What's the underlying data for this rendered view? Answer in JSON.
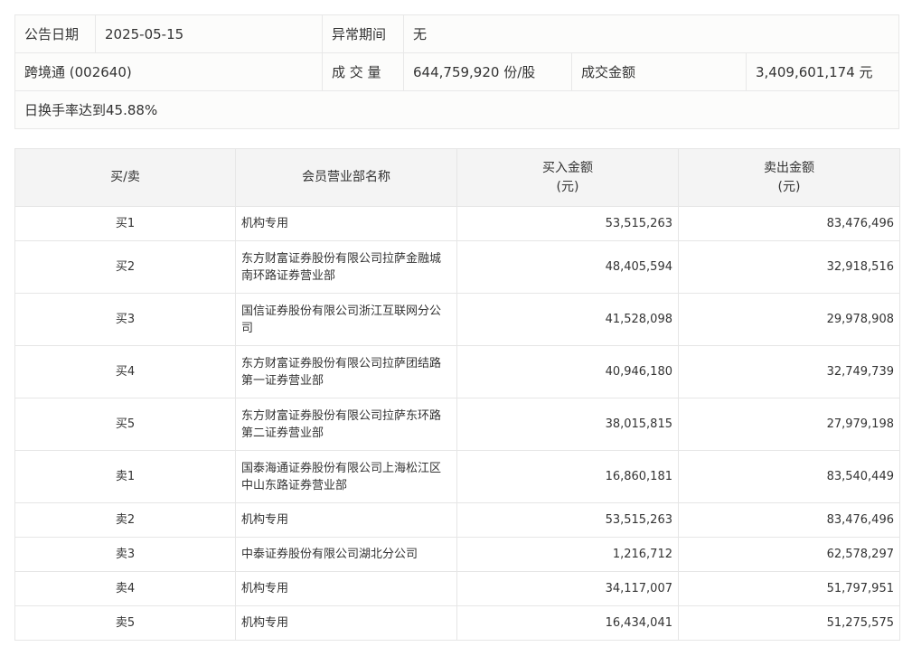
{
  "summary": {
    "date_label": "公告日期",
    "date_value": "2025-05-15",
    "anomaly_label": "异常期间",
    "anomaly_value": "无",
    "stock": "跨境通 (002640)",
    "volume_label": "成 交 量",
    "volume_value": "644,759,920 份/股",
    "amount_label": "成交金额",
    "amount_value": "3,409,601,174 元",
    "note": "日换手率达到45.88%"
  },
  "table": {
    "headers": {
      "side": "买/卖",
      "name": "会员营业部名称",
      "buy_title": "买入金额",
      "buy_unit": "(元)",
      "sell_title": "卖出金额",
      "sell_unit": "(元)"
    },
    "rows": [
      {
        "side": "买1",
        "name": "机构专用",
        "buy": "53,515,263",
        "sell": "83,476,496"
      },
      {
        "side": "买2",
        "name": "东方财富证券股份有限公司拉萨金融城南环路证券营业部",
        "buy": "48,405,594",
        "sell": "32,918,516"
      },
      {
        "side": "买3",
        "name": "国信证券股份有限公司浙江互联网分公司",
        "buy": "41,528,098",
        "sell": "29,978,908"
      },
      {
        "side": "买4",
        "name": "东方财富证券股份有限公司拉萨团结路第一证券营业部",
        "buy": "40,946,180",
        "sell": "32,749,739"
      },
      {
        "side": "买5",
        "name": "东方财富证券股份有限公司拉萨东环路第二证券营业部",
        "buy": "38,015,815",
        "sell": "27,979,198"
      },
      {
        "side": "卖1",
        "name": "国泰海通证券股份有限公司上海松江区中山东路证券营业部",
        "buy": "16,860,181",
        "sell": "83,540,449"
      },
      {
        "side": "卖2",
        "name": "机构专用",
        "buy": "53,515,263",
        "sell": "83,476,496"
      },
      {
        "side": "卖3",
        "name": "中泰证券股份有限公司湖北分公司",
        "buy": "1,216,712",
        "sell": "62,578,297"
      },
      {
        "side": "卖4",
        "name": "机构专用",
        "buy": "34,117,007",
        "sell": "51,797,951"
      },
      {
        "side": "卖5",
        "name": "机构专用",
        "buy": "16,434,041",
        "sell": "51,275,575"
      }
    ]
  }
}
